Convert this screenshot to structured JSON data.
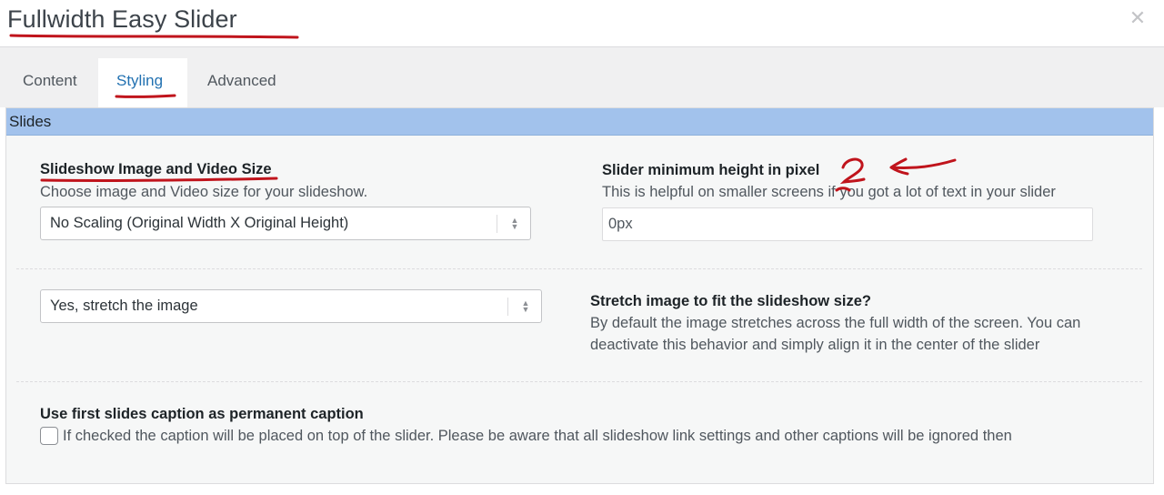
{
  "modal": {
    "title": "Fullwidth Easy Slider",
    "close_icon": "close-icon"
  },
  "tabs": [
    {
      "label": "Content",
      "active": false
    },
    {
      "label": "Styling",
      "active": true
    },
    {
      "label": "Advanced",
      "active": false
    }
  ],
  "section": {
    "title": "Slides"
  },
  "fields": {
    "image_size": {
      "label": "Slideshow Image and Video Size",
      "description": "Choose image and Video size for your slideshow.",
      "selected": "No Scaling (Original Width X Original Height)"
    },
    "min_height": {
      "label": "Slider minimum height in pixel",
      "description": "This is helpful on smaller screens if you got a lot of text in your slider",
      "value": "0px"
    },
    "stretch": {
      "label": "Stretch image to fit the slideshow size?",
      "description_line1": "By default the image stretches across the full width of the screen. You can",
      "description_line2": "deactivate this behavior and simply align it in the center of the slider",
      "selected": "Yes, stretch the image"
    },
    "caption": {
      "label": "Use first slides caption as permanent caption",
      "description": "If checked the caption will be placed on top of the slider. Please be aware that all slideshow link settings and other captions will be ignored then",
      "checked": false
    }
  },
  "colors": {
    "accent": "#2271b1",
    "section_bar": "#a2c2ec",
    "annotation": "#c0141c"
  }
}
